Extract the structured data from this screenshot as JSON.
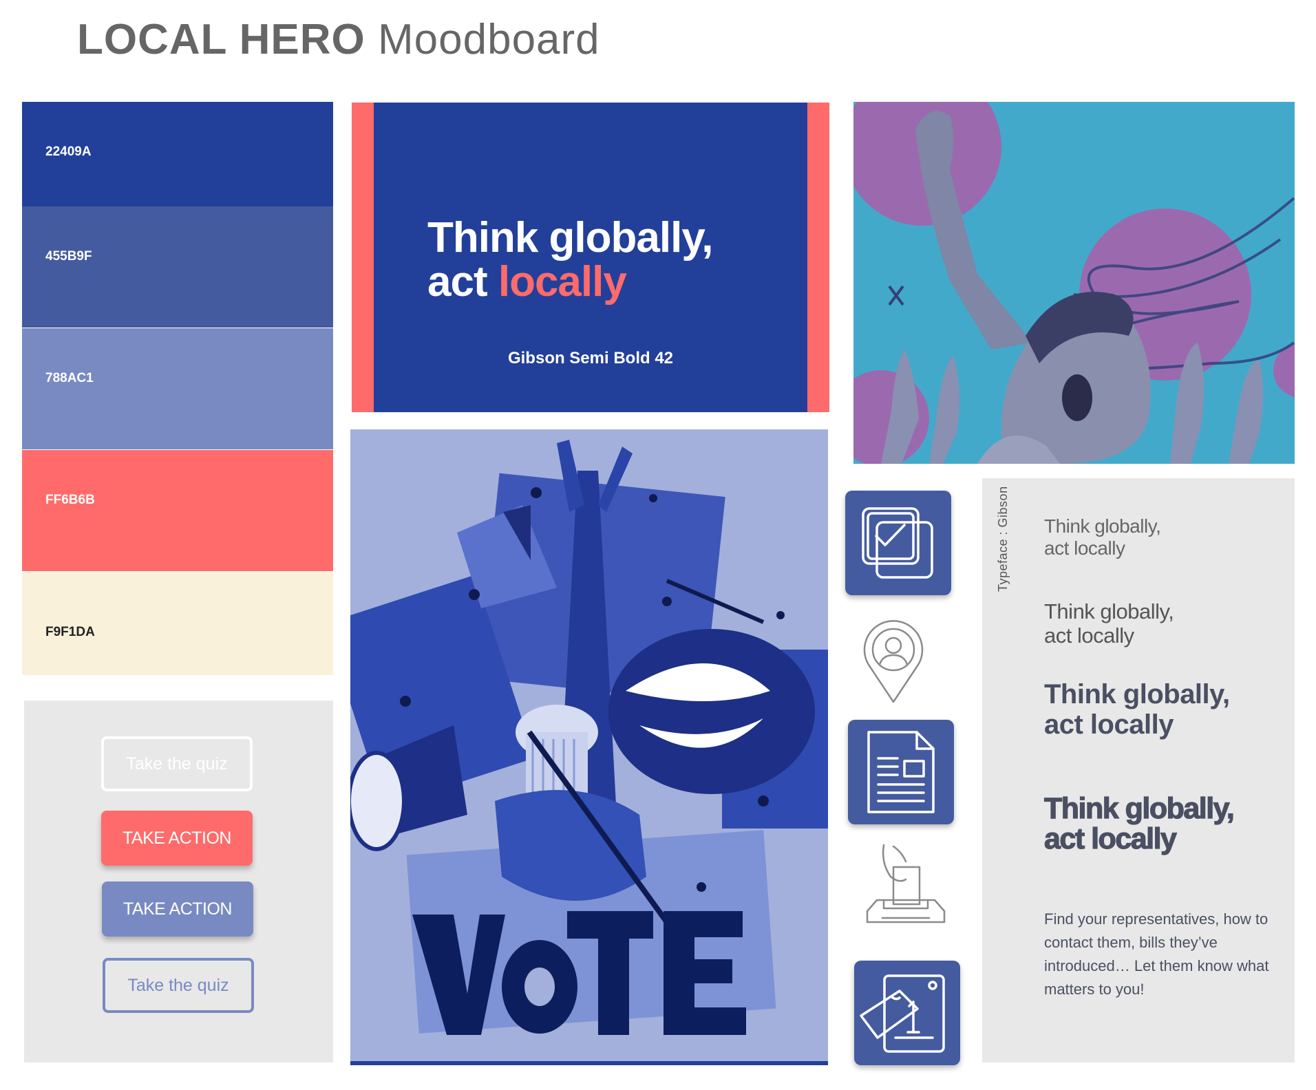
{
  "header": {
    "title_bold": "LOCAL HERO",
    "title_light": "Moodboard"
  },
  "palette": [
    {
      "hex": "22409A",
      "color": "#22409A"
    },
    {
      "hex": "455B9F",
      "color": "#455B9F"
    },
    {
      "hex": "788AC1",
      "color": "#788AC1"
    },
    {
      "hex": "FF6B6B",
      "color": "#FF6B6B"
    },
    {
      "hex": "F9F1DA",
      "color": "#F9F1DA"
    }
  ],
  "buttons": {
    "quiz_ghost": "Take the quiz",
    "action_coral": "TAKE ACTION",
    "action_periwinkle": "TAKE ACTION",
    "quiz_outline": "Take the quiz"
  },
  "headline": {
    "line1": "Think globally,",
    "line2_prefix": "act ",
    "line2_accent": "locally",
    "caption": "Gibson Semi Bold 42"
  },
  "collage": {
    "word": "VOTE"
  },
  "icons": [
    "checklist-icon",
    "location-person-icon",
    "document-icon",
    "ballot-box-icon",
    "calendar-ticket-icon"
  ],
  "typography": {
    "label": "Typeface : Gibson",
    "sample_line1": "Think globally,",
    "sample_line2": "act locally",
    "body": "Find your representatives, how to contact them, bills they’ve introduced… Let them know what matters to you!"
  }
}
